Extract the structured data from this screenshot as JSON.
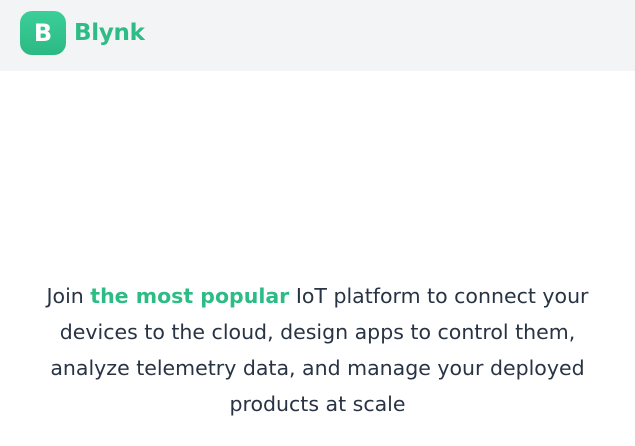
{
  "header": {
    "logo_letter": "B",
    "brand_name": "Blynk"
  },
  "hero": {
    "text_before": "Join ",
    "highlight": "the most popular",
    "text_after": " IoT platform to connect your devices to the cloud, design apps to control them, analyze telemetry data, and manage your deployed products at scale"
  },
  "colors": {
    "brand_green": "#2ebc86",
    "header_bg": "#f3f4f5",
    "text": "#283344"
  },
  "icons": {
    "logo": "blynk-logo-icon"
  }
}
